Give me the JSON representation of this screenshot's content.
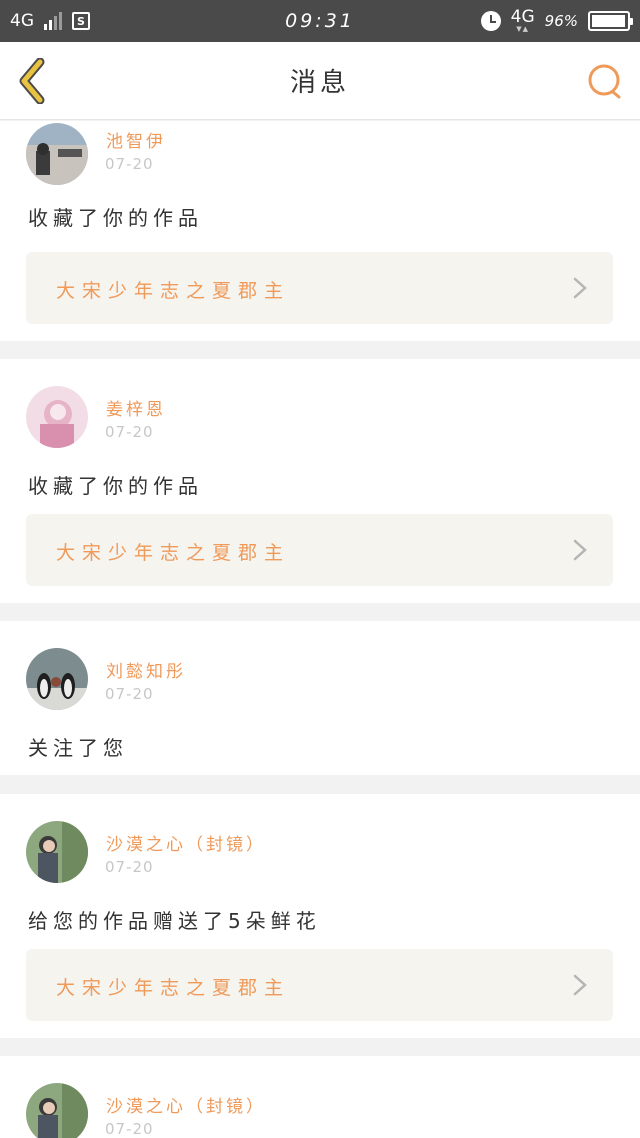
{
  "status_bar": {
    "network_left": "4G",
    "time": "09:31",
    "network_right": "4G",
    "battery_pct_text": "96%",
    "battery_level": 0.96
  },
  "header": {
    "title": "消息"
  },
  "messages": [
    {
      "name": "池智伊",
      "date": "07-20",
      "action": "收藏了你的作品",
      "work": "大宋少年志之夏郡主"
    },
    {
      "name": "姜梓恩",
      "date": "07-20",
      "action": "收藏了你的作品",
      "work": "大宋少年志之夏郡主"
    },
    {
      "name": "刘懿知彤",
      "date": "07-20",
      "action": "关注了您"
    },
    {
      "name": "沙漠之心（封镜）",
      "date": "07-20",
      "action": "给您的作品赠送了5朵鲜花",
      "work": "大宋少年志之夏郡主"
    },
    {
      "name": "沙漠之心（封镜）",
      "date": "07-20"
    }
  ],
  "colors": {
    "accent": "#f09a5a",
    "back_arrow": "#e8c240",
    "status_bar_bg": "#4a4a4a"
  },
  "icons": [
    "back-arrow-icon",
    "search-icon",
    "chevron-right-icon",
    "alarm-icon",
    "battery-icon",
    "signal-icon",
    "sim-icon"
  ]
}
